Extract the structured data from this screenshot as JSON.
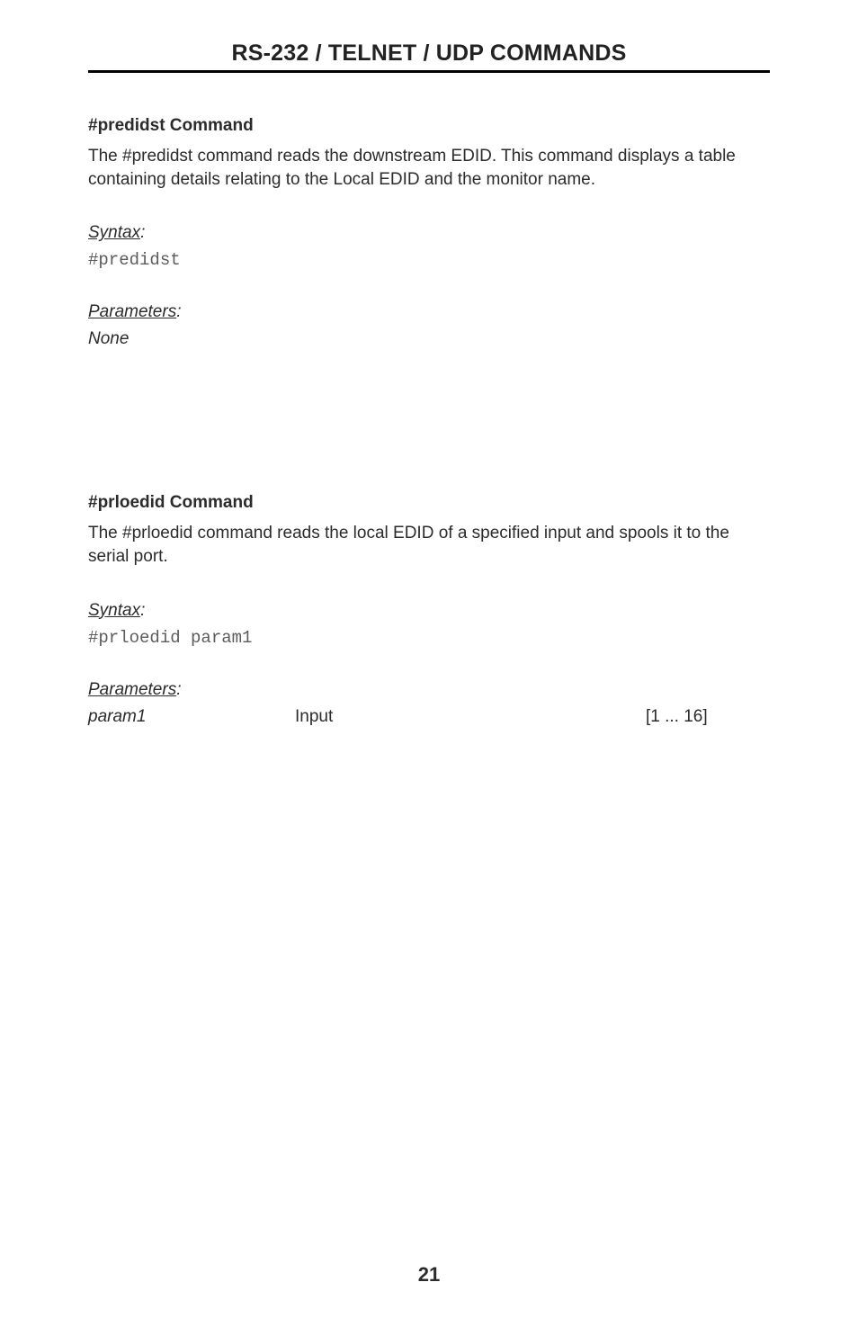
{
  "header": {
    "title": "RS-232 / TELNET / UDP COMMANDS"
  },
  "section1": {
    "title": "#predidst Command",
    "description": "The #predidst command reads the downstream EDID.  This command displays a table containing details relating to the Local EDID and the monitor name.",
    "syntax_label": "Syntax",
    "syntax_colon": ":",
    "syntax_code": "#predidst",
    "params_label": "Parameters",
    "params_colon": ":",
    "params_none": "None"
  },
  "section2": {
    "title": "#prloedid Command",
    "description": "The #prloedid command reads the local EDID of a specified input and spools it to the serial port.",
    "syntax_label": "Syntax",
    "syntax_colon": ":",
    "syntax_code": "#prloedid param1",
    "params_label": "Parameters",
    "params_colon": ":",
    "param_row": {
      "name": "param1",
      "desc": "Input",
      "range": "[1 ... 16]"
    }
  },
  "page_number": "21"
}
